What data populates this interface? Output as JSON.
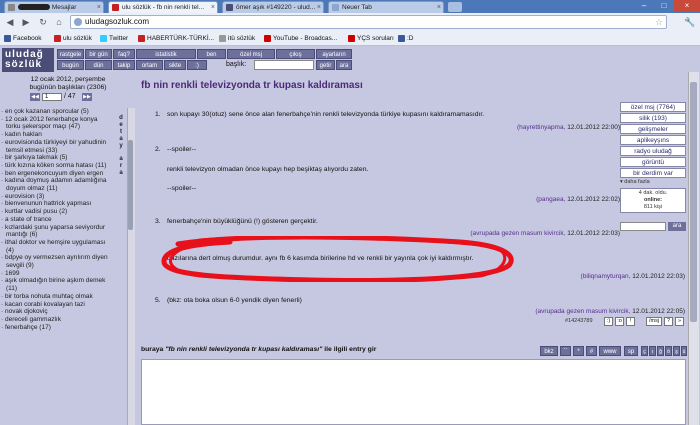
{
  "browser": {
    "tabs": [
      {
        "label": "Mesajlar",
        "icon_color": "#888888"
      },
      {
        "label": "ulu sözlük - fb nin renkli tel...",
        "icon_color": "#c62020"
      },
      {
        "label": "ömer aşık #149220 - ulud...",
        "icon_color": "#4b4d79"
      },
      {
        "label": "Neuer Tab",
        "icon_color": "#8aa7d1"
      }
    ],
    "url": "uludagsozluk.com",
    "bookmarks": [
      {
        "label": "Facebook",
        "icon_color": "#3b5998"
      },
      {
        "label": "ulu sözlük",
        "icon_color": "#c62020"
      },
      {
        "label": "Twitter",
        "icon_color": "#33ccff"
      },
      {
        "label": "HABERTÜRK-TÜRKİ...",
        "icon_color": "#c62020"
      },
      {
        "label": "itü sözlük",
        "icon_color": "#999999"
      },
      {
        "label": "YouTube - Broadcas...",
        "icon_color": "#cc0000"
      },
      {
        "label": "YÇS soruları",
        "icon_color": "#cc0000"
      },
      {
        "label": ":D",
        "icon_color": "#3b5998"
      }
    ]
  },
  "site": {
    "logo_line1": "uludağ",
    "logo_line2": "sözlük",
    "menu_row1": [
      "rastgele",
      "bir gün",
      "faq?",
      "istatistik",
      "ben",
      "özel msj",
      "çıkış",
      "ayarların"
    ],
    "menu_row2": [
      "bugün",
      "dün",
      "takip",
      "ortam",
      "sikte",
      ":)"
    ],
    "baslik_label": "başlık:",
    "getir": "getir",
    "ara": "ara"
  },
  "left": {
    "date_line1": "12 ocak 2012, perşembe",
    "date_line2": "bugünün başlıkları (2306)",
    "page_current": "1",
    "page_total": "/ 47",
    "detay": "detay",
    "ara": "ara",
    "topics": [
      "en çok kazanan sporcular (5)",
      "12 ocak 2012 fenerbahçe konya torku şekerspor maçı (47)",
      "kadın haklan",
      "eurovisionda türkiyeyi bir yahudinin temsil etmesi (33)",
      "bir şarkıya takmak (5)",
      "türk kızına köken sorma hatası (11)",
      "ben ergenekoncuyum diyen ergen",
      "kadına doymuş adamın adamlığına doyum olmaz (11)",
      "eurovision (3)",
      "bienvenunun hattrick yapması",
      "kurtlar vadisi pusu (2)",
      "a state of trance",
      "kızlardaki şunu yaparsa seviyordur mantığı (6)",
      "ithal doktor ve hemşire uygulaması (4)",
      "bdpye oy vermezsen ayrılırım diyen sevgili (9)",
      "1699",
      "aşık olmadığın birine aşkım demek (11)",
      "bir torba nohuta muhtaç olmak",
      "kacan corabi kovalayan tazi",
      "novak djokoviç",
      "dereceli gammazlık",
      "fenerbahçe (17)"
    ]
  },
  "main": {
    "title": "fb nin renkli televizyonda tr kupası kaldıraması",
    "entries": [
      {
        "num": "1.",
        "text": "son kupayı 30(otuz) sene önce alan fenerbahçe'nin renkli televizyonda türkiye kupasını kaldıramamasıdır.",
        "author": "(hayrettinyapma,",
        "date": "12.01.2012 22:00)"
      },
      {
        "num": "2.",
        "spoiler": "--spoiler--",
        "text": "renkli televizyon olmadan önce kupayı hep beşiktaş alıyordu zaten.",
        "spoiler_end": "--spoiler--",
        "author": "(pangaea,",
        "date": "12.01.2012 22:02)"
      },
      {
        "num": "3.",
        "text": "fenerbahçe'nin büyüklüğünü (!) gösteren gerçektir.",
        "author": "(avrupada gezen masum kivircik,",
        "date": "12.01.2012 22:03)"
      },
      {
        "num": "4.",
        "text": "bazılarına dert olmuş durumdur. aynı fb 6 kasımda birilerine hd ve renkli bir yayınla çok iyi kaldırmıştır.",
        "author": "(biliqnamyturqan,",
        "date": "12.01.2012 22:03)"
      },
      {
        "num": "5.",
        "text": "(bkz: ota boka olsun 6-0 yendik diyen fenerli)",
        "author": "(avrupada gezen masum kivircik,",
        "date": "12.01.2012 22:05)"
      }
    ],
    "entry_id": "#14243789",
    "entry_buttons": [
      ":)",
      ":o",
      "!",
      "/msj",
      "?",
      "»"
    ],
    "compose_prefix": "buraya",
    "compose_title": "\"fb nin renkli televizyonda tr kupası kaldıraması\"",
    "compose_suffix": "ile ilgili entry gir",
    "toolbar_buttons": [
      "bkz",
      "``",
      "*",
      "#",
      "www",
      "sp"
    ],
    "char_buttons": [
      "ç",
      "ı",
      "ğ",
      "ö",
      "ş",
      "ü"
    ]
  },
  "right": {
    "items": [
      "özel msj (7764)",
      "silik (193)",
      "gelişmeler",
      "aplikeyşıns",
      "radyo uludağ",
      "görüntü",
      "bir derdim var"
    ],
    "more": "▾ daha fazla",
    "status_line1": "4 dak. oldu.",
    "status_line2": "online:",
    "status_line3": "811 kişi",
    "ara": "ara"
  },
  "colors": {
    "accent": "#4b4d79",
    "title": "#4b2a7a",
    "author": "#56308f",
    "scribble": "#e8101a"
  }
}
